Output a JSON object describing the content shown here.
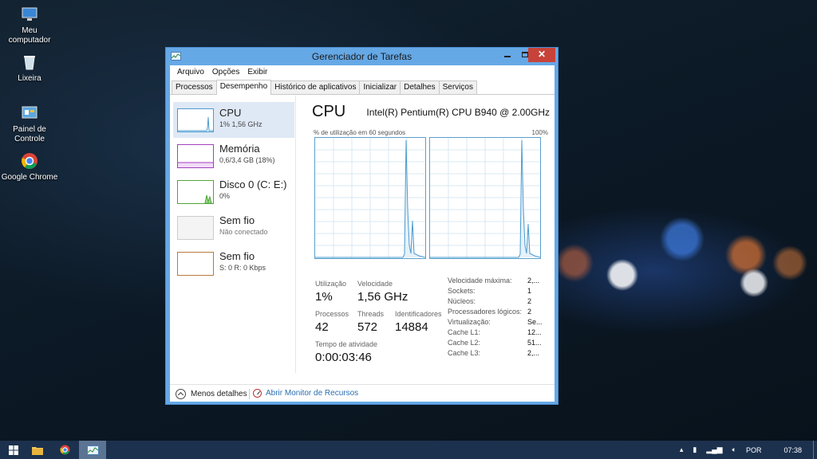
{
  "desktop": {
    "icons": [
      {
        "label": "Meu computador",
        "icon": "computer-icon"
      },
      {
        "label": "Lixeira",
        "icon": "recycle-bin-icon"
      },
      {
        "label": "Painel de Controle",
        "icon": "control-panel-icon"
      },
      {
        "label": "Google Chrome",
        "icon": "chrome-icon"
      }
    ]
  },
  "window": {
    "title": "Gerenciador de Tarefas",
    "menu": [
      "Arquivo",
      "Opções",
      "Exibir"
    ],
    "tabs": [
      "Processos",
      "Desempenho",
      "Histórico de aplicativos",
      "Inicializar",
      "Detalhes",
      "Serviços"
    ],
    "active_tab": "Desempenho",
    "resources": [
      {
        "name": "CPU",
        "sub": "1% 1,56 GHz",
        "color": "#4b9bd0",
        "selected": true
      },
      {
        "name": "Memória",
        "sub": "0,6/3,4 GB (18%)",
        "color": "#a43fc0"
      },
      {
        "name": "Disco 0 (C: E:)",
        "sub": "0%",
        "color": "#4fa53a"
      },
      {
        "name": "Sem fio",
        "sub": "Não conectado",
        "color": "#bbbbbb"
      },
      {
        "name": "Sem fio",
        "sub": "S: 0 R: 0 Kbps",
        "color": "#b87a3a"
      }
    ],
    "detail": {
      "title": "CPU",
      "model": "Intel(R) Pentium(R) CPU B940 @ 2.00GHz",
      "util_label": "% de utilização em 60 segundos",
      "max_pct": "100%",
      "stats": {
        "utilizacao_label": "Utilização",
        "utilizacao": "1%",
        "velocidade_label": "Velocidade",
        "velocidade": "1,56 GHz",
        "processos_label": "Processos",
        "processos": "42",
        "threads_label": "Threads",
        "threads": "572",
        "identificadores_label": "Identificadores",
        "identificadores": "14884",
        "tempo_label": "Tempo de atividade",
        "tempo": "0:00:03:46"
      },
      "specs": [
        {
          "k": "Velocidade máxima:",
          "v": "2,..."
        },
        {
          "k": "Sockets:",
          "v": "1"
        },
        {
          "k": "Núcleos:",
          "v": "2"
        },
        {
          "k": "Processadores lógicos:",
          "v": "2"
        },
        {
          "k": "Virtualização:",
          "v": "Se..."
        },
        {
          "k": "Cache L1:",
          "v": "12..."
        },
        {
          "k": "Cache L2:",
          "v": "51..."
        },
        {
          "k": "Cache L3:",
          "v": "2,..."
        }
      ]
    },
    "footer": {
      "fewer_details": "Menos detalhes",
      "resource_monitor": "Abrir Monitor de Recursos"
    }
  },
  "taskbar": {
    "language": "POR",
    "time": "07:38"
  }
}
